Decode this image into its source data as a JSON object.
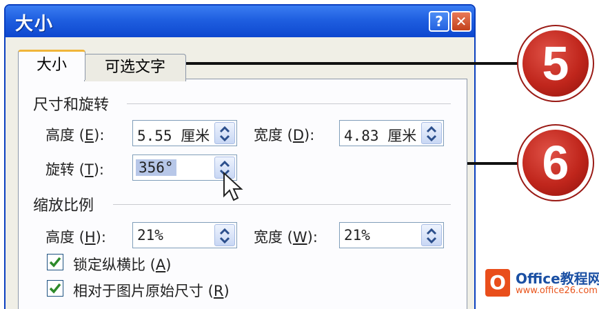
{
  "dialog": {
    "title": "大小",
    "help_label": "?",
    "close_label": "✕"
  },
  "tabs": [
    {
      "label": "大小",
      "active": true
    },
    {
      "label": "可选文字",
      "active": false
    }
  ],
  "size_rotate": {
    "header": "尺寸和旋转",
    "height_label": "高度",
    "height_key": "E",
    "height_value": "5.55 厘米",
    "width_label": "宽度",
    "width_key": "D",
    "width_value": "4.83 厘米",
    "rotate_label": "旋转",
    "rotate_key": "T",
    "rotate_value": "356°"
  },
  "scale": {
    "header": "缩放比例",
    "height_label": "高度",
    "height_key": "H",
    "height_value": "21%",
    "width_label": "宽度",
    "width_key": "W",
    "width_value": "21%",
    "lock_label": "锁定纵横比",
    "lock_key": "A",
    "lock_checked": true,
    "relative_label": "相对于图片原始尺寸",
    "relative_key": "R",
    "relative_checked": true
  },
  "callouts": [
    {
      "number": "5"
    },
    {
      "number": "6"
    }
  ],
  "watermark": {
    "logo": "O",
    "name": "Office教程网",
    "url": "www.office26.com"
  },
  "colors": {
    "titlebar": "#1f5fe0",
    "badge": "#c0261c",
    "selection": "#b7c7e8",
    "check": "#2d8a2a"
  }
}
